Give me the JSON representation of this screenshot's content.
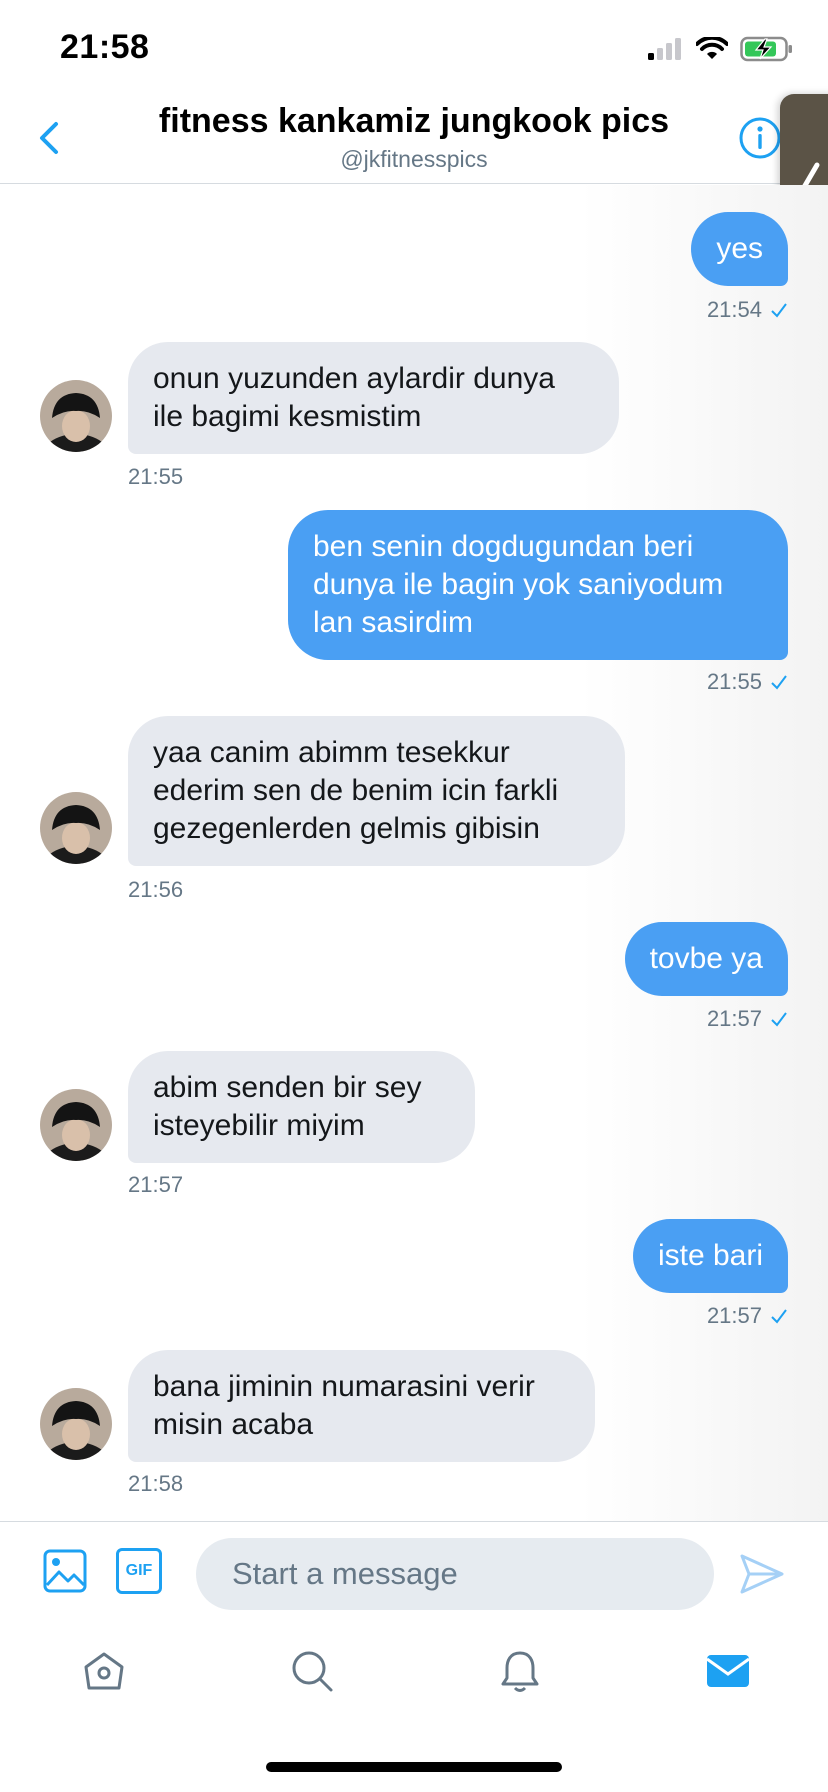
{
  "status_bar": {
    "time": "21:58"
  },
  "header": {
    "title": "fitness kankamiz jungkook pics",
    "handle": "@jkfitnesspics"
  },
  "messages": [
    {
      "direction": "out",
      "lines": [
        "yes"
      ],
      "time": "21:54",
      "read": true
    },
    {
      "direction": "in",
      "lines": [
        "onun yuzunden aylardir dunya",
        "ile bagimi kesmistim"
      ],
      "time": "21:55"
    },
    {
      "direction": "out",
      "lines": [
        "ben senin dogdugundan beri",
        "dunya ile bagin yok saniyodum",
        "lan sasirdim"
      ],
      "time": "21:55",
      "read": true
    },
    {
      "direction": "in",
      "lines": [
        "yaa canim abimm tesekkur",
        "ederim sen de benim icin farkli",
        "gezegenlerden gelmis gibisin"
      ],
      "time": "21:56"
    },
    {
      "direction": "out",
      "lines": [
        "tovbe ya"
      ],
      "time": "21:57",
      "read": true
    },
    {
      "direction": "in",
      "lines": [
        "abim senden bir sey",
        "isteyebilir miyim"
      ],
      "time": "21:57"
    },
    {
      "direction": "out",
      "lines": [
        "iste bari"
      ],
      "time": "21:57",
      "read": true
    },
    {
      "direction": "in",
      "lines": [
        "bana jiminin numarasini verir",
        "misin acaba"
      ],
      "time": "21:58"
    }
  ],
  "composer": {
    "placeholder": "Start a message",
    "gif_label": "GIF"
  },
  "colors": {
    "accent": "#1da1f2",
    "bubble_out": "#4a9ff3",
    "bubble_in": "#e6e9ef",
    "muted": "#657786"
  },
  "icons": {
    "back": "chevron-left-icon",
    "info": "info-icon",
    "image": "image-icon",
    "gif": "gif-icon",
    "send": "send-icon",
    "tabs": [
      "home-icon",
      "search-icon",
      "bell-icon",
      "mail-icon"
    ]
  }
}
